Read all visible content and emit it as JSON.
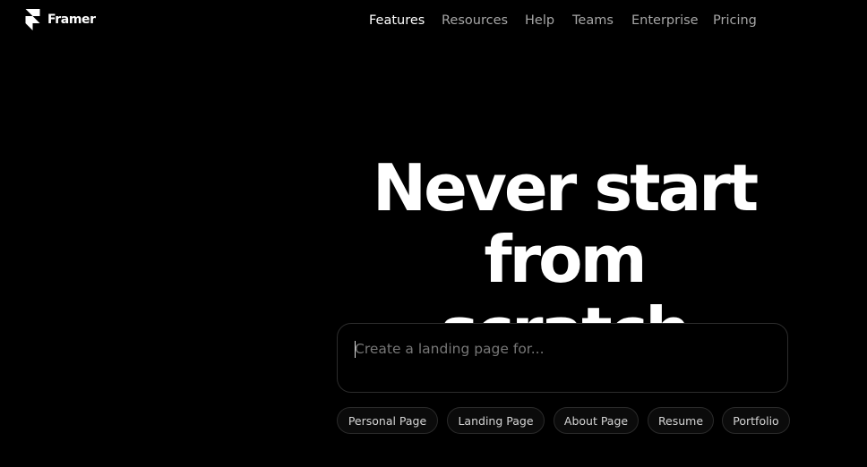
{
  "brand": {
    "name": "Framer",
    "logo_icon": "framer-logo-icon"
  },
  "nav": {
    "items": [
      {
        "label": "Features"
      },
      {
        "label": "Resources"
      },
      {
        "label": "Help"
      },
      {
        "label": "Teams"
      },
      {
        "label": "Enterprise"
      },
      {
        "label": "Pricing"
      }
    ],
    "active": "Features"
  },
  "hero": {
    "line1": "Never start",
    "line2": "from scratch"
  },
  "prompt": {
    "value": "",
    "placeholder": "Create a landing page for..."
  },
  "suggestions": [
    {
      "label": "Personal Page"
    },
    {
      "label": "Landing Page"
    },
    {
      "label": "About Page"
    },
    {
      "label": "Resume"
    },
    {
      "label": "Portfolio"
    }
  ],
  "colors": {
    "background": "#000000",
    "text_primary": "#ffffff",
    "nav_inactive": "#a6a6a6",
    "border": "#2c2c2c"
  }
}
